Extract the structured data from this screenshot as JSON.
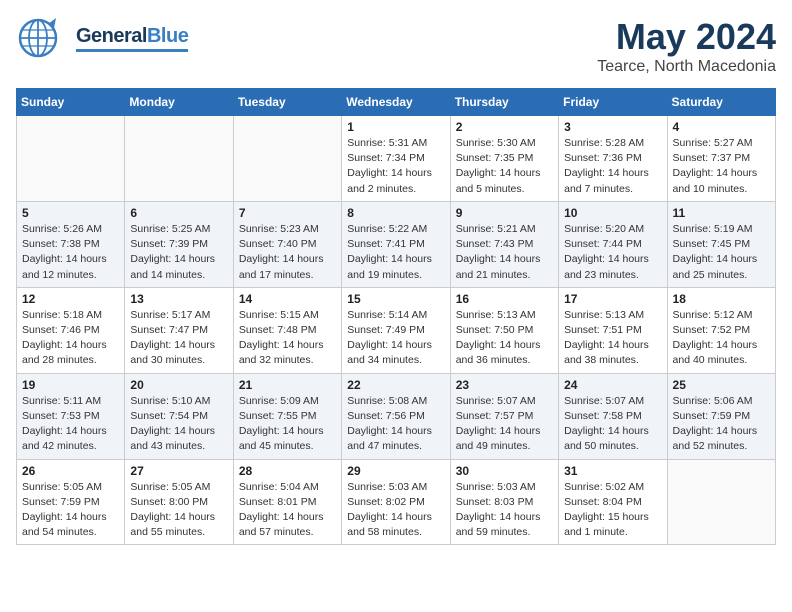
{
  "header": {
    "logo_general": "General",
    "logo_blue": "Blue",
    "title": "May 2024",
    "subtitle": "Tearce, North Macedonia"
  },
  "calendar": {
    "days_of_week": [
      "Sunday",
      "Monday",
      "Tuesday",
      "Wednesday",
      "Thursday",
      "Friday",
      "Saturday"
    ],
    "weeks": [
      [
        {
          "num": "",
          "info": ""
        },
        {
          "num": "",
          "info": ""
        },
        {
          "num": "",
          "info": ""
        },
        {
          "num": "1",
          "info": "Sunrise: 5:31 AM\nSunset: 7:34 PM\nDaylight: 14 hours\nand 2 minutes."
        },
        {
          "num": "2",
          "info": "Sunrise: 5:30 AM\nSunset: 7:35 PM\nDaylight: 14 hours\nand 5 minutes."
        },
        {
          "num": "3",
          "info": "Sunrise: 5:28 AM\nSunset: 7:36 PM\nDaylight: 14 hours\nand 7 minutes."
        },
        {
          "num": "4",
          "info": "Sunrise: 5:27 AM\nSunset: 7:37 PM\nDaylight: 14 hours\nand 10 minutes."
        }
      ],
      [
        {
          "num": "5",
          "info": "Sunrise: 5:26 AM\nSunset: 7:38 PM\nDaylight: 14 hours\nand 12 minutes."
        },
        {
          "num": "6",
          "info": "Sunrise: 5:25 AM\nSunset: 7:39 PM\nDaylight: 14 hours\nand 14 minutes."
        },
        {
          "num": "7",
          "info": "Sunrise: 5:23 AM\nSunset: 7:40 PM\nDaylight: 14 hours\nand 17 minutes."
        },
        {
          "num": "8",
          "info": "Sunrise: 5:22 AM\nSunset: 7:41 PM\nDaylight: 14 hours\nand 19 minutes."
        },
        {
          "num": "9",
          "info": "Sunrise: 5:21 AM\nSunset: 7:43 PM\nDaylight: 14 hours\nand 21 minutes."
        },
        {
          "num": "10",
          "info": "Sunrise: 5:20 AM\nSunset: 7:44 PM\nDaylight: 14 hours\nand 23 minutes."
        },
        {
          "num": "11",
          "info": "Sunrise: 5:19 AM\nSunset: 7:45 PM\nDaylight: 14 hours\nand 25 minutes."
        }
      ],
      [
        {
          "num": "12",
          "info": "Sunrise: 5:18 AM\nSunset: 7:46 PM\nDaylight: 14 hours\nand 28 minutes."
        },
        {
          "num": "13",
          "info": "Sunrise: 5:17 AM\nSunset: 7:47 PM\nDaylight: 14 hours\nand 30 minutes."
        },
        {
          "num": "14",
          "info": "Sunrise: 5:15 AM\nSunset: 7:48 PM\nDaylight: 14 hours\nand 32 minutes."
        },
        {
          "num": "15",
          "info": "Sunrise: 5:14 AM\nSunset: 7:49 PM\nDaylight: 14 hours\nand 34 minutes."
        },
        {
          "num": "16",
          "info": "Sunrise: 5:13 AM\nSunset: 7:50 PM\nDaylight: 14 hours\nand 36 minutes."
        },
        {
          "num": "17",
          "info": "Sunrise: 5:13 AM\nSunset: 7:51 PM\nDaylight: 14 hours\nand 38 minutes."
        },
        {
          "num": "18",
          "info": "Sunrise: 5:12 AM\nSunset: 7:52 PM\nDaylight: 14 hours\nand 40 minutes."
        }
      ],
      [
        {
          "num": "19",
          "info": "Sunrise: 5:11 AM\nSunset: 7:53 PM\nDaylight: 14 hours\nand 42 minutes."
        },
        {
          "num": "20",
          "info": "Sunrise: 5:10 AM\nSunset: 7:54 PM\nDaylight: 14 hours\nand 43 minutes."
        },
        {
          "num": "21",
          "info": "Sunrise: 5:09 AM\nSunset: 7:55 PM\nDaylight: 14 hours\nand 45 minutes."
        },
        {
          "num": "22",
          "info": "Sunrise: 5:08 AM\nSunset: 7:56 PM\nDaylight: 14 hours\nand 47 minutes."
        },
        {
          "num": "23",
          "info": "Sunrise: 5:07 AM\nSunset: 7:57 PM\nDaylight: 14 hours\nand 49 minutes."
        },
        {
          "num": "24",
          "info": "Sunrise: 5:07 AM\nSunset: 7:58 PM\nDaylight: 14 hours\nand 50 minutes."
        },
        {
          "num": "25",
          "info": "Sunrise: 5:06 AM\nSunset: 7:59 PM\nDaylight: 14 hours\nand 52 minutes."
        }
      ],
      [
        {
          "num": "26",
          "info": "Sunrise: 5:05 AM\nSunset: 7:59 PM\nDaylight: 14 hours\nand 54 minutes."
        },
        {
          "num": "27",
          "info": "Sunrise: 5:05 AM\nSunset: 8:00 PM\nDaylight: 14 hours\nand 55 minutes."
        },
        {
          "num": "28",
          "info": "Sunrise: 5:04 AM\nSunset: 8:01 PM\nDaylight: 14 hours\nand 57 minutes."
        },
        {
          "num": "29",
          "info": "Sunrise: 5:03 AM\nSunset: 8:02 PM\nDaylight: 14 hours\nand 58 minutes."
        },
        {
          "num": "30",
          "info": "Sunrise: 5:03 AM\nSunset: 8:03 PM\nDaylight: 14 hours\nand 59 minutes."
        },
        {
          "num": "31",
          "info": "Sunrise: 5:02 AM\nSunset: 8:04 PM\nDaylight: 15 hours\nand 1 minute."
        },
        {
          "num": "",
          "info": ""
        }
      ]
    ]
  }
}
